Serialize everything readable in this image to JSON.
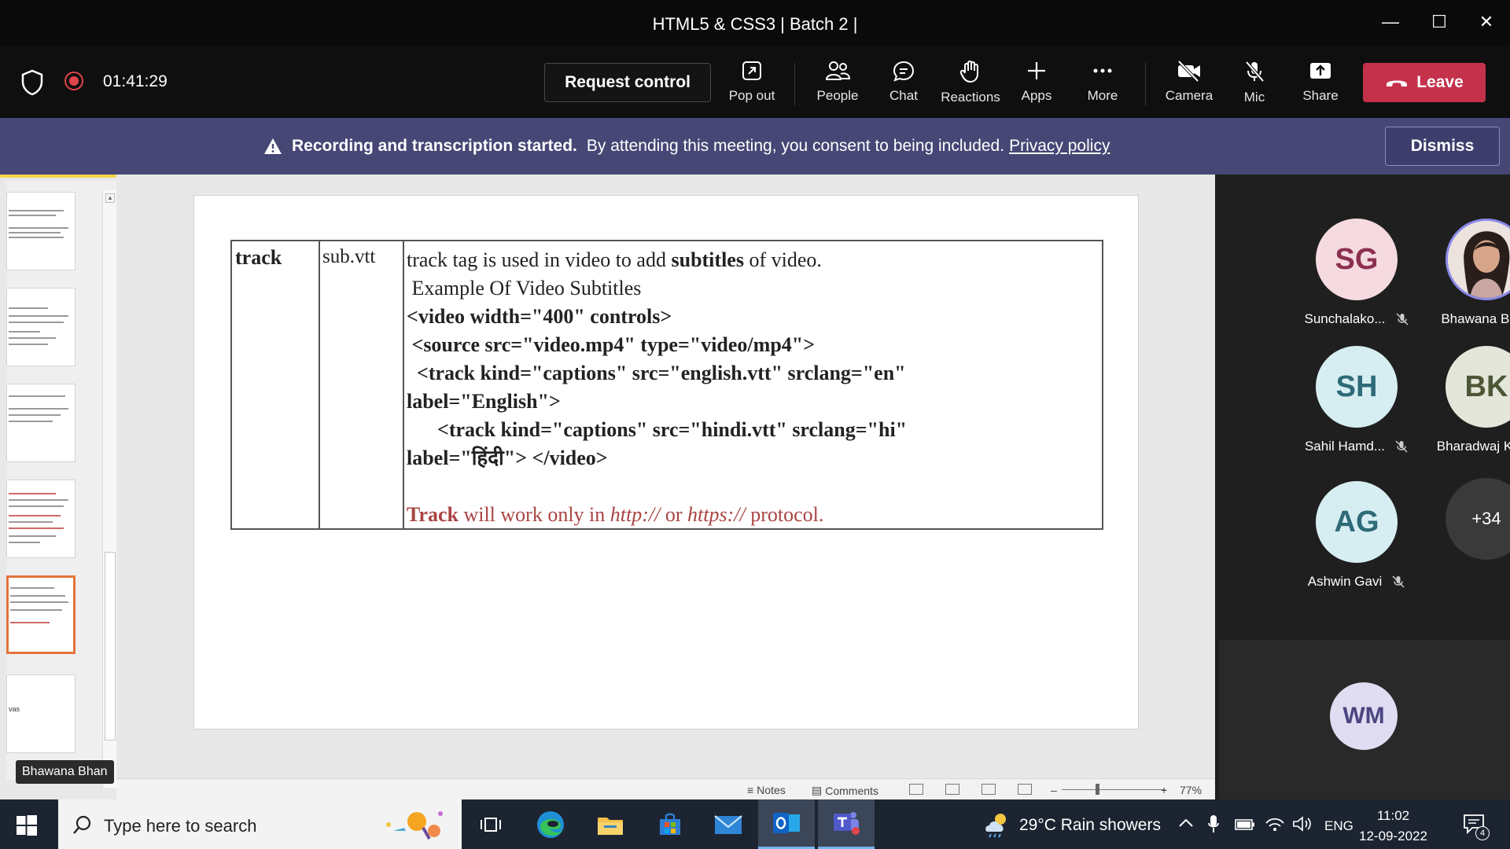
{
  "window": {
    "title": "HTML5 & CSS3 | Batch 2 |"
  },
  "toolbar": {
    "timer": "01:41:29",
    "request_control": "Request control",
    "items": {
      "pop_out": "Pop out",
      "people": "People",
      "chat": "Chat",
      "reactions": "Reactions",
      "apps": "Apps",
      "more": "More",
      "camera": "Camera",
      "mic": "Mic",
      "share": "Share"
    },
    "leave": "Leave"
  },
  "banner": {
    "strong": "Recording and transcription started.",
    "text": "By attending this meeting, you consent to being included.",
    "link": "Privacy policy",
    "dismiss": "Dismiss"
  },
  "slide": {
    "col1": "track",
    "col2": "sub.vtt",
    "line1_a": "track tag is used in video to add ",
    "line1_b": "subtitles",
    "line1_c": " of video.",
    "line2": " Example Of Video Subtitles",
    "line3": "<video width=\"400\" controls>",
    "line4": " <source src=\"video.mp4\" type=\"video/mp4\">",
    "line5": "  <track kind=\"captions\" src=\"english.vtt\" srclang=\"en\"",
    "line6": "label=\"English\">",
    "line7": "      <track kind=\"captions\" src=\"hindi.vtt\" srclang=\"hi\"",
    "line8": "label=\"हिंदी\"> </video>",
    "note_a": "Track",
    "note_b": " will work only in ",
    "note_c": "http://",
    "note_d": " or ",
    "note_e": "https://",
    "note_f": " protocol."
  },
  "thumbnail_word": "vas",
  "presenter_label": "Bhawana Bhan",
  "statusbar": {
    "notes": "Notes",
    "comments": "Comments",
    "zoom": "77%"
  },
  "participants": [
    {
      "initials": "SG",
      "name": "Sunchalako...",
      "muted": true,
      "color": "#f5dbe0",
      "text_color": "#8c3050"
    },
    {
      "initials": "",
      "name": "Bhawana Bhan",
      "muted": false,
      "photo": true
    },
    {
      "initials": "SH",
      "name": "Sahil Hamd...",
      "muted": true,
      "color": "#d6eef2",
      "text_color": "#2e6a78"
    },
    {
      "initials": "BK",
      "name": "Bharadwaj K",
      "muted": true,
      "color": "#e4e6da",
      "text_color": "#4d5636"
    },
    {
      "initials": "AG",
      "name": "Ashwin Gavi",
      "muted": true,
      "color": "#d6eef2",
      "text_color": "#2e6a78"
    },
    {
      "initials": "+34",
      "name": "",
      "muted": false,
      "color": "#3a3a3a",
      "text_color": "#ffffff"
    }
  ],
  "self_view": {
    "initials": "WM",
    "color": "#e0dcf2",
    "text_color": "#4b4580"
  },
  "taskbar": {
    "search_placeholder": "Type here to search",
    "weather": "29°C  Rain showers",
    "lang": "ENG",
    "time": "11:02",
    "date": "12-09-2022",
    "notifications": "4"
  }
}
